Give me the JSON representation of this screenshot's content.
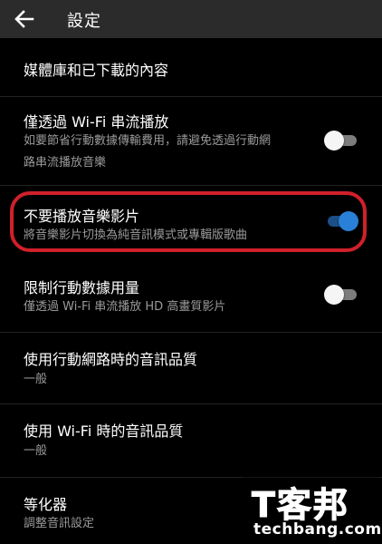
{
  "app_bar": {
    "back_icon": "arrow-left-icon",
    "title": "設定"
  },
  "settings": {
    "library": {
      "title": "媒體庫和已下載的內容"
    },
    "wifi_streaming": {
      "title": "僅透過 Wi-Fi 串流播放",
      "subtitle_line1": "如要節省行動數據傳輸費用，請避免透過行動網",
      "subtitle_line2": "路串流播放音樂",
      "toggle": "off"
    },
    "no_music_video": {
      "title": "不要播放音樂影片",
      "subtitle": "將音樂影片切換為純音訊模式或專輯版歌曲",
      "toggle": "on"
    },
    "limit_mobile_data": {
      "title": "限制行動數據用量",
      "subtitle": "僅透過 Wi-Fi 串流播放 HD 高畫質影片",
      "toggle": "off"
    },
    "mobile_audio_quality": {
      "title": "使用行動網路時的音訊品質",
      "subtitle": "一般"
    },
    "wifi_audio_quality": {
      "title": "使用 Wi-Fi 時的音訊品質",
      "subtitle": "一般"
    },
    "equalizer": {
      "title": "等化器",
      "subtitle": "調整音訊設定"
    }
  },
  "watermark": {
    "logo_text": "T客邦",
    "site": "techbang.com"
  },
  "colors": {
    "background": "#000000",
    "app_bar": "#2b2b2b",
    "toggle_on": "#2a7fd8",
    "highlight": "#d0202a"
  }
}
